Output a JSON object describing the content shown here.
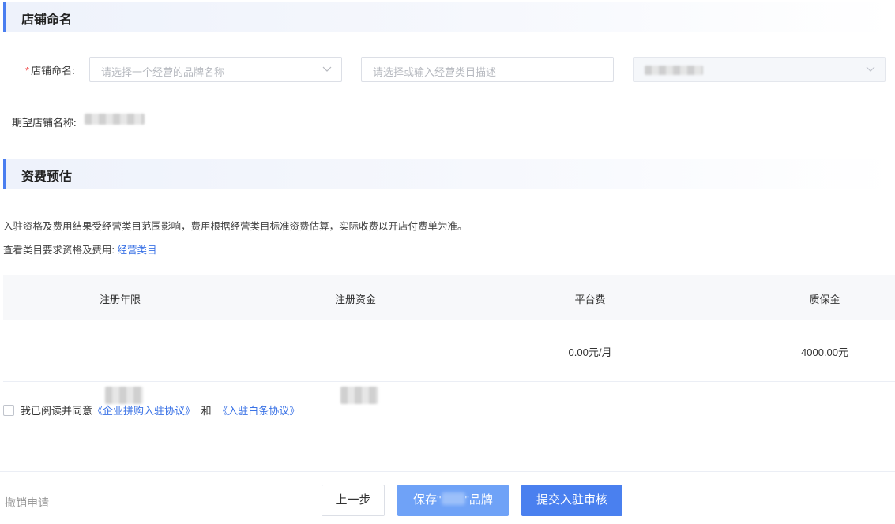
{
  "store_naming": {
    "section_title": "店铺命名",
    "field_label": "店铺命名:",
    "required_mark": "*",
    "brand_select_placeholder": "请选择一个经营的品牌名称",
    "category_input_placeholder": "请选择或输入经营类目描述",
    "expected_name_label": "期望店铺名称:"
  },
  "fee_estimate": {
    "section_title": "资费预估",
    "notice": "入驻资格及费用结果受经营类目范围影响，费用根据经营类目标准资费估算，实际收费以开店付费单为准。",
    "view_prefix": "查看类目要求资格及费用:",
    "view_link": "经营类目",
    "table": {
      "headers": [
        "注册年限",
        "注册资金",
        "平台费",
        "质保金"
      ],
      "row": {
        "platform_fee": "0.00元/月",
        "deposit": "4000.00元"
      }
    }
  },
  "agreement": {
    "text": "我已阅读并同意",
    "link1": "《企业拼购入驻协议》",
    "joiner": "和",
    "link2": "《入驻白条协议》"
  },
  "footer": {
    "cancel_label": "撤销申请",
    "prev_label": "上一步",
    "save_prefix": "保存\"",
    "save_suffix": "\"品牌",
    "submit_label": "提交入驻审核"
  },
  "colors": {
    "accent": "#4a80ef",
    "link": "#3b73e6",
    "required": "#f04848"
  }
}
